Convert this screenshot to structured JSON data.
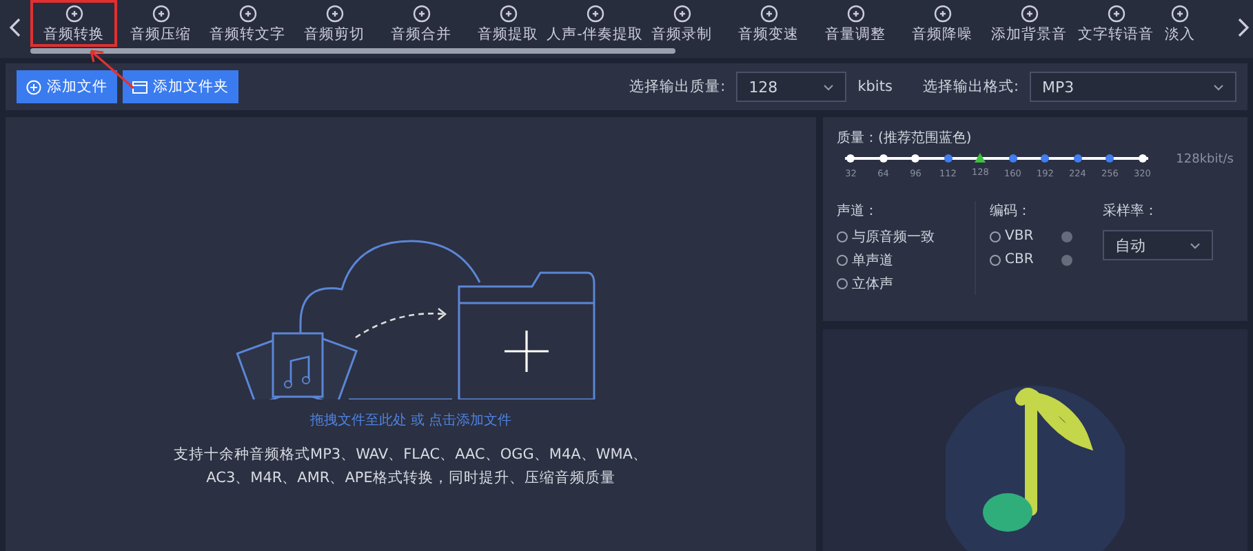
{
  "toolbar": {
    "tools": [
      {
        "label": "音频转换",
        "selected": true
      },
      {
        "label": "音频压缩",
        "selected": false
      },
      {
        "label": "音频转文字",
        "selected": false
      },
      {
        "label": "音频剪切",
        "selected": false
      },
      {
        "label": "音频合并",
        "selected": false
      },
      {
        "label": "音频提取",
        "selected": false
      },
      {
        "label": "人声-伴奏提取",
        "selected": false
      },
      {
        "label": "音频录制",
        "selected": false
      },
      {
        "label": "音频变速",
        "selected": false
      },
      {
        "label": "音量调整",
        "selected": false
      },
      {
        "label": "音频降噪",
        "selected": false
      },
      {
        "label": "添加背景音",
        "selected": false
      },
      {
        "label": "文字转语音",
        "selected": false
      },
      {
        "label": "淡入",
        "selected": false
      }
    ]
  },
  "actions": {
    "add_file": "添加文件",
    "add_folder": "添加文件夹",
    "quality_label": "选择输出质量:",
    "quality_value": "128",
    "quality_unit": "kbits",
    "format_label": "选择输出格式:",
    "format_value": "MP3"
  },
  "drop_zone": {
    "hint": "拖拽文件至此处 或 点击添加文件",
    "description": "支持十余种音频格式MP3、WAV、FLAC、AAC、OGG、M4A、WMA、AC3、M4R、AMR、APE格式转换，同时提升、压缩音频质量"
  },
  "settings": {
    "quality_title": "质量：(推荐范围蓝色)",
    "reading": "128kbit/s",
    "ticks": [
      {
        "label": "32",
        "recommended": false,
        "selected": false
      },
      {
        "label": "64",
        "recommended": false,
        "selected": false
      },
      {
        "label": "96",
        "recommended": false,
        "selected": false
      },
      {
        "label": "112",
        "recommended": true,
        "selected": false
      },
      {
        "label": "128",
        "recommended": true,
        "selected": true
      },
      {
        "label": "160",
        "recommended": true,
        "selected": false
      },
      {
        "label": "192",
        "recommended": true,
        "selected": false
      },
      {
        "label": "224",
        "recommended": true,
        "selected": false
      },
      {
        "label": "256",
        "recommended": true,
        "selected": false
      },
      {
        "label": "320",
        "recommended": false,
        "selected": false
      }
    ],
    "channel_title": "声道：",
    "channels": [
      {
        "label": "与原音频一致",
        "selected": false
      },
      {
        "label": "单声道",
        "selected": false
      },
      {
        "label": "立体声",
        "selected": false
      }
    ],
    "encoding_title": "编码：",
    "encodings": [
      {
        "label": "VBR",
        "selected": false
      },
      {
        "label": "CBR",
        "selected": false
      }
    ],
    "sample_rate_title": "采样率：",
    "sample_rate_value": "自动"
  }
}
